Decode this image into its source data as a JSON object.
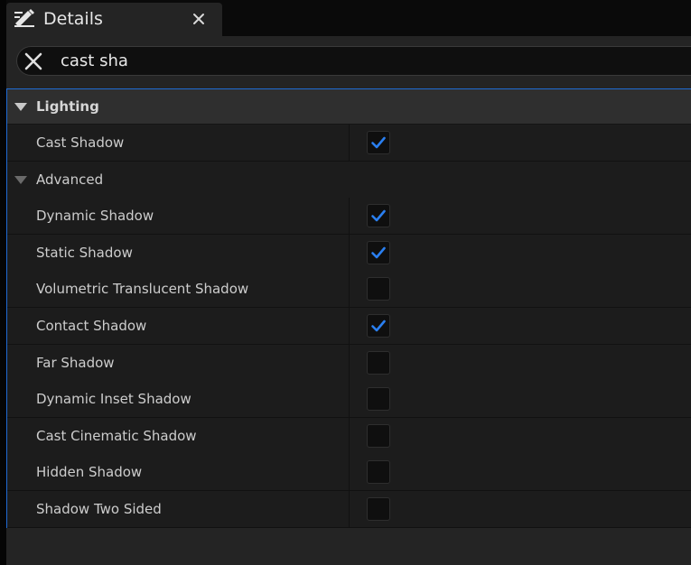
{
  "tab": {
    "title": "Details",
    "icon": "pencil-details-icon",
    "close_icon": "close-icon"
  },
  "search": {
    "value": "cast sha",
    "clear_icon": "clear-x-icon"
  },
  "category": {
    "label": "Lighting",
    "expanded": true
  },
  "rows": [
    {
      "label": "Cast Shadow",
      "checked": true
    },
    {
      "type": "subcategory",
      "label": "Advanced",
      "expanded": true
    },
    {
      "label": "Dynamic Shadow",
      "checked": true
    },
    {
      "label": "Static Shadow",
      "checked": true
    },
    {
      "label": "Volumetric Translucent Shadow",
      "checked": false
    },
    {
      "label": "Contact Shadow",
      "checked": true
    },
    {
      "label": "Far Shadow",
      "checked": false
    },
    {
      "label": "Dynamic Inset Shadow",
      "checked": false
    },
    {
      "label": "Cast Cinematic Shadow",
      "checked": false
    },
    {
      "label": "Hidden Shadow",
      "checked": false
    },
    {
      "label": "Shadow Two Sided",
      "checked": false
    }
  ],
  "colors": {
    "accent": "#1f6bd3",
    "check": "#2a7ff0"
  }
}
